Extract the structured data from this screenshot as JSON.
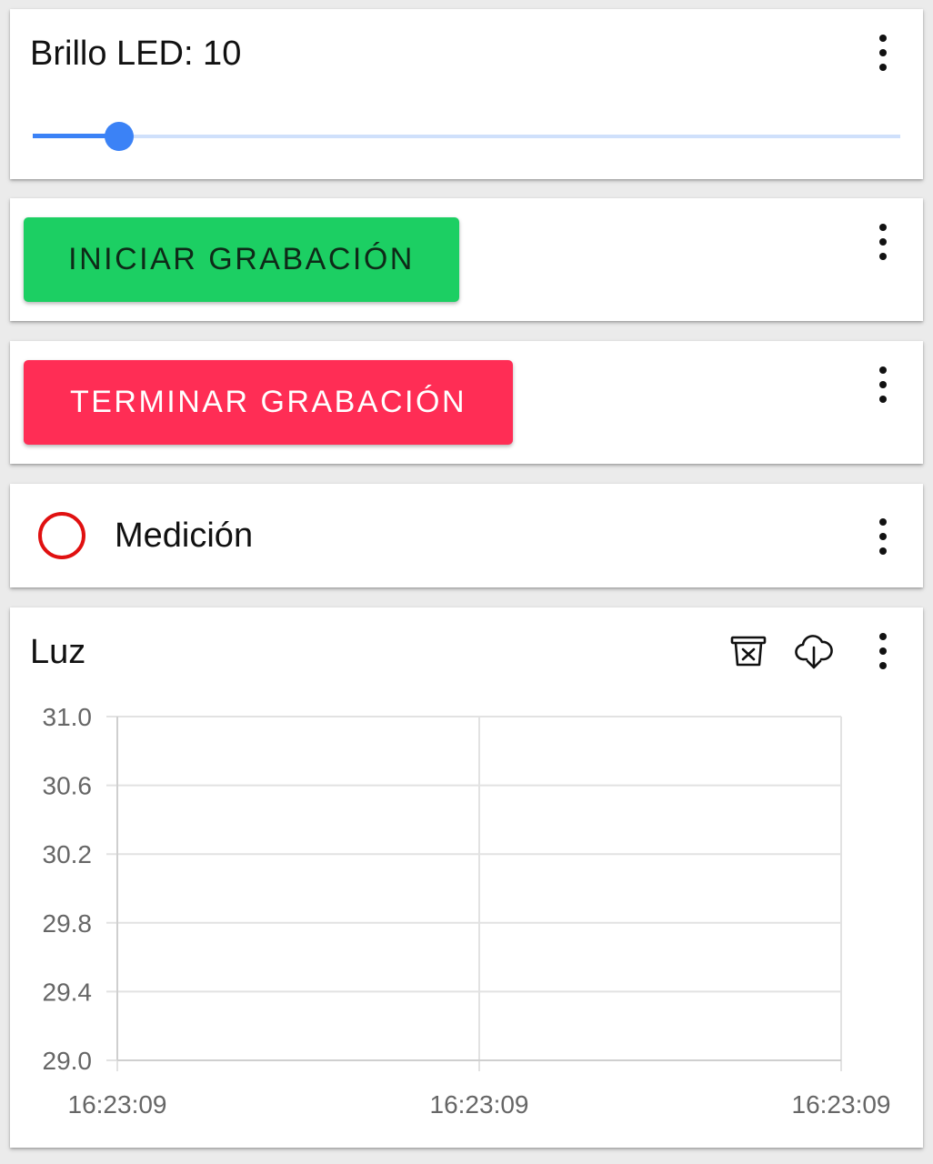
{
  "slider_card": {
    "label": "Brillo LED: 10",
    "value": 10,
    "min": 0,
    "max": 100
  },
  "start_card": {
    "button_label": "INICIAR GRABACIÓN"
  },
  "stop_card": {
    "button_label": "TERMINAR GRABACIÓN"
  },
  "led_card": {
    "label": "Medición",
    "led_color": "#e01010"
  },
  "chart_card": {
    "title": "Luz",
    "icons": [
      "trash-icon",
      "cloud-download-icon",
      "more-vert-icon"
    ]
  },
  "colors": {
    "accent": "#3b82f6",
    "start": "#1ccf63",
    "stop": "#ff2d55"
  },
  "chart_data": {
    "type": "line",
    "title": "",
    "xlabel": "",
    "ylabel": "",
    "ylim": [
      29.0,
      31.0
    ],
    "y_ticks": [
      "31.0",
      "30.6",
      "30.2",
      "29.8",
      "29.4",
      "29.0"
    ],
    "x_ticks": [
      "16:23:09",
      "16:23:09",
      "16:23:09"
    ],
    "grid": true,
    "series": []
  }
}
